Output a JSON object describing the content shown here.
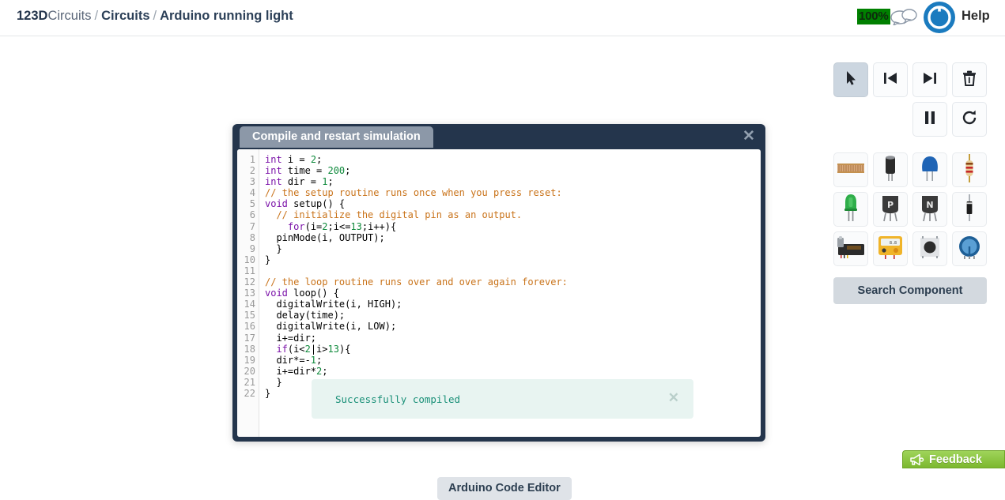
{
  "header": {
    "breadcrumb": {
      "brand_bold": "123D",
      "brand_light": "Circuits",
      "separator": "/",
      "section": "Circuits",
      "current": "Arduino running light"
    },
    "zoom_badge": "100%",
    "chat_icon": "chat-bubbles-icon",
    "logo_icon": "power-circle-logo",
    "help_label": "Help"
  },
  "left_toolbar": {
    "items": [
      {
        "name": "breadboard-tool",
        "icon": "breadboard-icon",
        "active": true
      },
      {
        "name": "schematic-tool",
        "icon": "capacitor-schematic-icon",
        "active": false
      },
      {
        "name": "pcb-tool",
        "icon": "chip-ic-icon",
        "active": false
      },
      {
        "name": "components-list-tool",
        "icon": "bullet-list-icon",
        "active": false
      },
      {
        "name": "settings-tool",
        "icon": "gear-icon",
        "active": false
      }
    ]
  },
  "canvas": {
    "code_editor_tab_label": "Arduino Code Editor"
  },
  "modal": {
    "title": "Compile and restart simulation",
    "close_icon": "close-icon",
    "toast": {
      "message": "Successfully compiled",
      "close_icon": "close-icon"
    },
    "code": {
      "lines": [
        {
          "n": "1",
          "tokens": [
            {
              "t": "int",
              "c": "kw"
            },
            {
              "t": " i = ",
              "c": ""
            },
            {
              "t": "2",
              "c": "num"
            },
            {
              "t": ";",
              "c": ""
            }
          ]
        },
        {
          "n": "2",
          "tokens": [
            {
              "t": "int",
              "c": "kw"
            },
            {
              "t": " time = ",
              "c": ""
            },
            {
              "t": "200",
              "c": "num"
            },
            {
              "t": ";",
              "c": ""
            }
          ]
        },
        {
          "n": "3",
          "tokens": [
            {
              "t": "int",
              "c": "kw"
            },
            {
              "t": " dir = ",
              "c": ""
            },
            {
              "t": "1",
              "c": "num"
            },
            {
              "t": ";",
              "c": ""
            }
          ]
        },
        {
          "n": "4",
          "tokens": [
            {
              "t": "// the setup routine runs once when you press reset:",
              "c": "com"
            }
          ]
        },
        {
          "n": "5",
          "tokens": [
            {
              "t": "void",
              "c": "kw"
            },
            {
              "t": " setup() {",
              "c": ""
            }
          ]
        },
        {
          "n": "6",
          "tokens": [
            {
              "t": "  ",
              "c": ""
            },
            {
              "t": "// initialize the digital pin as an output.",
              "c": "com"
            }
          ]
        },
        {
          "n": "7",
          "tokens": [
            {
              "t": "    ",
              "c": ""
            },
            {
              "t": "for",
              "c": "kw"
            },
            {
              "t": "(i=",
              "c": ""
            },
            {
              "t": "2",
              "c": "num"
            },
            {
              "t": ";i<=",
              "c": ""
            },
            {
              "t": "13",
              "c": "num"
            },
            {
              "t": ";i++){",
              "c": ""
            }
          ]
        },
        {
          "n": "8",
          "tokens": [
            {
              "t": "  pinMode(i, OUTPUT);",
              "c": ""
            }
          ]
        },
        {
          "n": "9",
          "tokens": [
            {
              "t": "  }",
              "c": ""
            }
          ]
        },
        {
          "n": "10",
          "tokens": [
            {
              "t": "}",
              "c": ""
            }
          ]
        },
        {
          "n": "11",
          "tokens": [
            {
              "t": "",
              "c": ""
            }
          ]
        },
        {
          "n": "12",
          "tokens": [
            {
              "t": "// the loop routine runs over and over again forever:",
              "c": "com"
            }
          ]
        },
        {
          "n": "13",
          "tokens": [
            {
              "t": "void",
              "c": "kw"
            },
            {
              "t": " loop() {",
              "c": ""
            }
          ]
        },
        {
          "n": "14",
          "tokens": [
            {
              "t": "  digitalWrite(i, HIGH);",
              "c": ""
            }
          ]
        },
        {
          "n": "15",
          "tokens": [
            {
              "t": "  delay(time);",
              "c": ""
            }
          ]
        },
        {
          "n": "16",
          "tokens": [
            {
              "t": "  digitalWrite(i, LOW);",
              "c": ""
            }
          ]
        },
        {
          "n": "17",
          "tokens": [
            {
              "t": "  i+=dir;",
              "c": ""
            }
          ]
        },
        {
          "n": "18",
          "tokens": [
            {
              "t": "  ",
              "c": ""
            },
            {
              "t": "if",
              "c": "kw"
            },
            {
              "t": "(i<",
              "c": ""
            },
            {
              "t": "2",
              "c": "num"
            },
            {
              "t": "|i>",
              "c": ""
            },
            {
              "t": "13",
              "c": "num"
            },
            {
              "t": "){",
              "c": ""
            }
          ]
        },
        {
          "n": "19",
          "tokens": [
            {
              "t": "  dir*=-",
              "c": ""
            },
            {
              "t": "1",
              "c": "num"
            },
            {
              "t": ";",
              "c": ""
            }
          ]
        },
        {
          "n": "20",
          "tokens": [
            {
              "t": "  i+=dir*",
              "c": ""
            },
            {
              "t": "2",
              "c": "num"
            },
            {
              "t": ";",
              "c": ""
            }
          ]
        },
        {
          "n": "21",
          "tokens": [
            {
              "t": "  }",
              "c": ""
            }
          ]
        },
        {
          "n": "22",
          "tokens": [
            {
              "t": "}",
              "c": ""
            }
          ]
        }
      ]
    }
  },
  "right_panel": {
    "sim_controls": [
      {
        "name": "select-tool-button",
        "icon": "cursor-arrow-icon",
        "active": true
      },
      {
        "name": "step-back-button",
        "icon": "skip-previous-icon",
        "active": false
      },
      {
        "name": "step-forward-button",
        "icon": "skip-next-icon",
        "active": false
      },
      {
        "name": "delete-button",
        "icon": "trash-icon",
        "active": false
      },
      {
        "name": "pause-button",
        "icon": "pause-icon",
        "active": false
      },
      {
        "name": "restart-button",
        "icon": "refresh-icon",
        "active": false
      }
    ],
    "components": [
      {
        "name": "component-breadboard",
        "icon": "breadboard-icon"
      },
      {
        "name": "component-electrolytic-cap",
        "icon": "electrolytic-capacitor-icon"
      },
      {
        "name": "component-ceramic-cap",
        "icon": "ceramic-capacitor-icon"
      },
      {
        "name": "component-resistor",
        "icon": "resistor-icon"
      },
      {
        "name": "component-led",
        "icon": "led-icon"
      },
      {
        "name": "component-pnp-transistor",
        "icon": "pnp-transistor-icon",
        "label": "P"
      },
      {
        "name": "component-npn-transistor",
        "icon": "npn-transistor-icon",
        "label": "N"
      },
      {
        "name": "component-diode",
        "icon": "diode-icon"
      },
      {
        "name": "component-arduino",
        "icon": "arduino-board-icon"
      },
      {
        "name": "component-multimeter",
        "icon": "multimeter-icon"
      },
      {
        "name": "component-pushbutton",
        "icon": "pushbutton-icon"
      },
      {
        "name": "component-potentiometer",
        "icon": "potentiometer-icon"
      }
    ],
    "search_button_label": "Search Component"
  },
  "feedback": {
    "label": "Feedback",
    "icon": "megaphone-icon"
  }
}
